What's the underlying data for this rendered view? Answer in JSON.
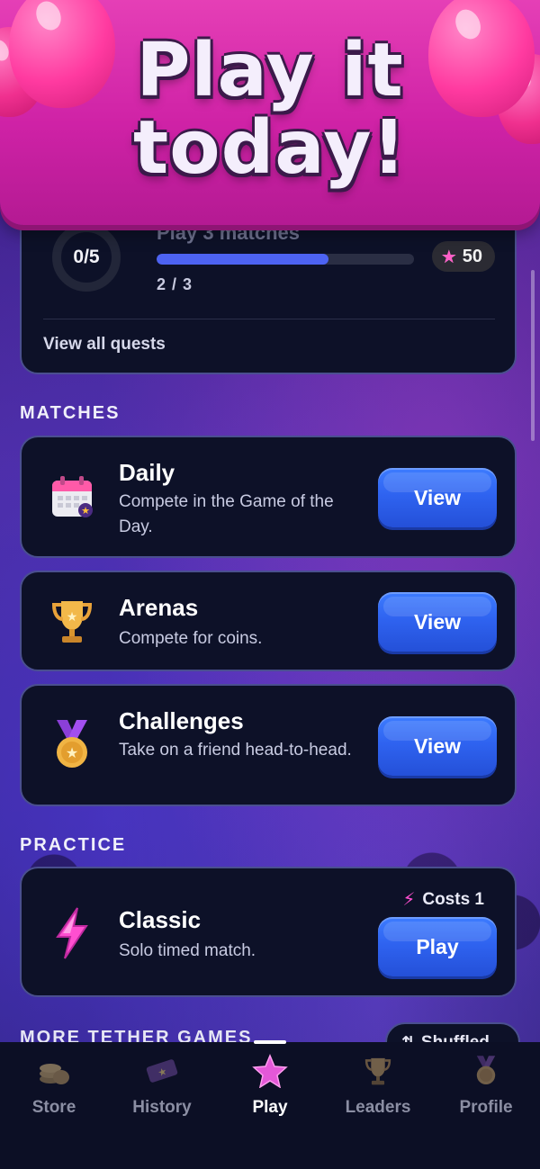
{
  "banner": {
    "title": "Play it\ntoday!"
  },
  "quests": {
    "progress_ring": "0/5",
    "current_title": "Play 3 matches",
    "current_count": "2 / 3",
    "progress_fraction": 0.667,
    "reward_amount": "50",
    "view_all_label": "View all quests"
  },
  "sections": {
    "matches": "MATCHES",
    "practice": "PRACTICE",
    "more": "MORE TETHER GAMES"
  },
  "matches": [
    {
      "title": "Daily",
      "description": "Compete in the Game of the Day.",
      "button": "View",
      "icon": "calendar-icon"
    },
    {
      "title": "Arenas",
      "description": "Compete for coins.",
      "button": "View",
      "icon": "trophy-icon"
    },
    {
      "title": "Challenges",
      "description": "Take on a friend head-to-head.",
      "button": "View",
      "icon": "medal-icon"
    }
  ],
  "practice": {
    "title": "Classic",
    "description": "Solo timed match.",
    "button": "Play",
    "cost_label": "Costs 1",
    "icon": "lightning-bolt-icon"
  },
  "shuffled": {
    "label": "Shuffled"
  },
  "nav": [
    {
      "label": "Store",
      "icon": "coin-stack-icon"
    },
    {
      "label": "History",
      "icon": "ticket-icon"
    },
    {
      "label": "Play",
      "icon": "star-icon",
      "active": true
    },
    {
      "label": "Leaders",
      "icon": "trophy-icon"
    },
    {
      "label": "Profile",
      "icon": "medal-icon"
    }
  ],
  "colors": {
    "banner": "#d22aa9",
    "button": "#2f63f0",
    "card": "#0d1128",
    "progress": "#4d63f2"
  }
}
